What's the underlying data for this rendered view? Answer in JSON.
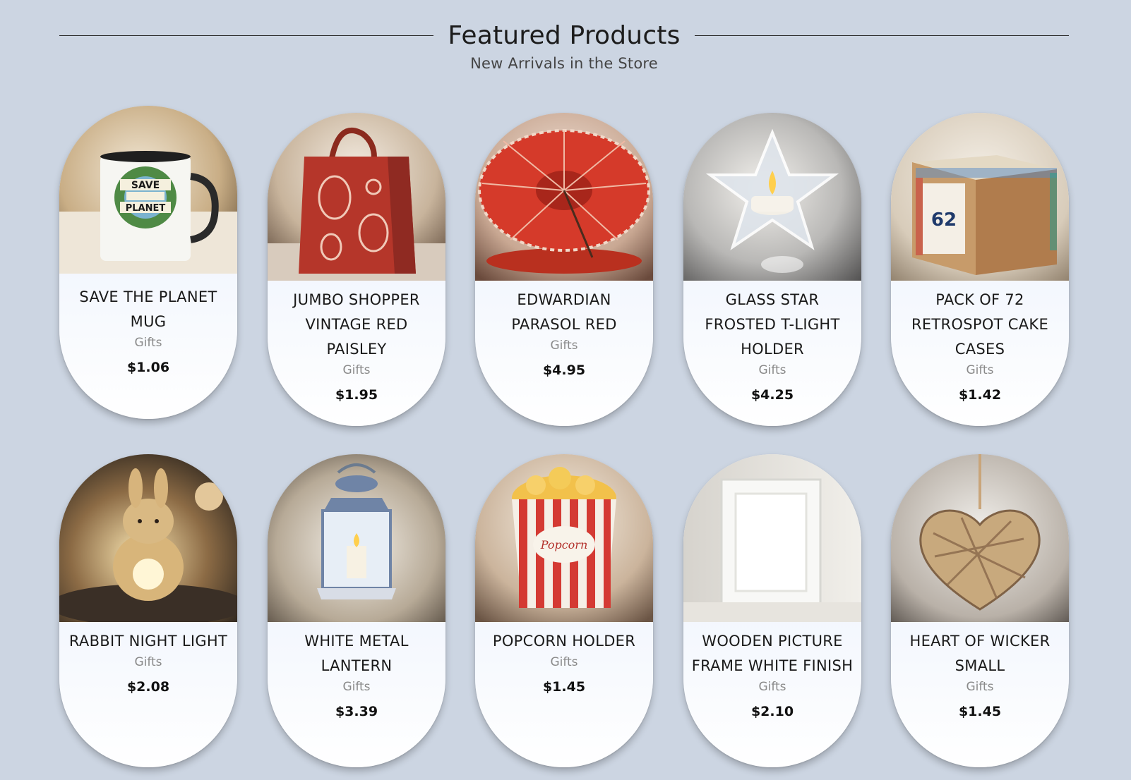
{
  "header": {
    "title": "Featured Products",
    "subtitle": "New Arrivals in the Store"
  },
  "products": [
    {
      "name": "SAVE THE PLANET MUG",
      "category": "Gifts",
      "price": "$1.06",
      "image_icon": "mug-image",
      "image_text": "SAVE THE PLANET"
    },
    {
      "name": "JUMBO SHOPPER VINTAGE RED PAISLEY",
      "category": "Gifts",
      "price": "$1.95",
      "image_icon": "paisley-tote-bag-image"
    },
    {
      "name": "EDWARDIAN PARASOL RED",
      "category": "Gifts",
      "price": "$4.95",
      "image_icon": "red-parasol-image"
    },
    {
      "name": "GLASS STAR FROSTED T-LIGHT HOLDER",
      "category": "Gifts",
      "price": "$4.25",
      "image_icon": "star-candle-holder-image"
    },
    {
      "name": "PACK OF 72 RETROSPOT CAKE CASES",
      "category": "Gifts",
      "price": "$1.42",
      "image_icon": "cake-cases-box-image",
      "image_text": "62"
    },
    {
      "name": "RABBIT NIGHT LIGHT",
      "category": "Gifts",
      "price": "$2.08",
      "image_icon": "rabbit-lamp-image"
    },
    {
      "name": "WHITE METAL LANTERN",
      "category": "Gifts",
      "price": "$3.39",
      "image_icon": "lantern-image"
    },
    {
      "name": "POPCORN HOLDER",
      "category": "Gifts",
      "price": "$1.45",
      "image_icon": "popcorn-box-image",
      "image_text": "Popcorn"
    },
    {
      "name": "WOODEN PICTURE FRAME WHITE FINISH",
      "category": "Gifts",
      "price": "$2.10",
      "image_icon": "picture-frame-image"
    },
    {
      "name": "HEART OF WICKER SMALL",
      "category": "Gifts",
      "price": "$1.45",
      "image_icon": "wicker-heart-image"
    }
  ]
}
